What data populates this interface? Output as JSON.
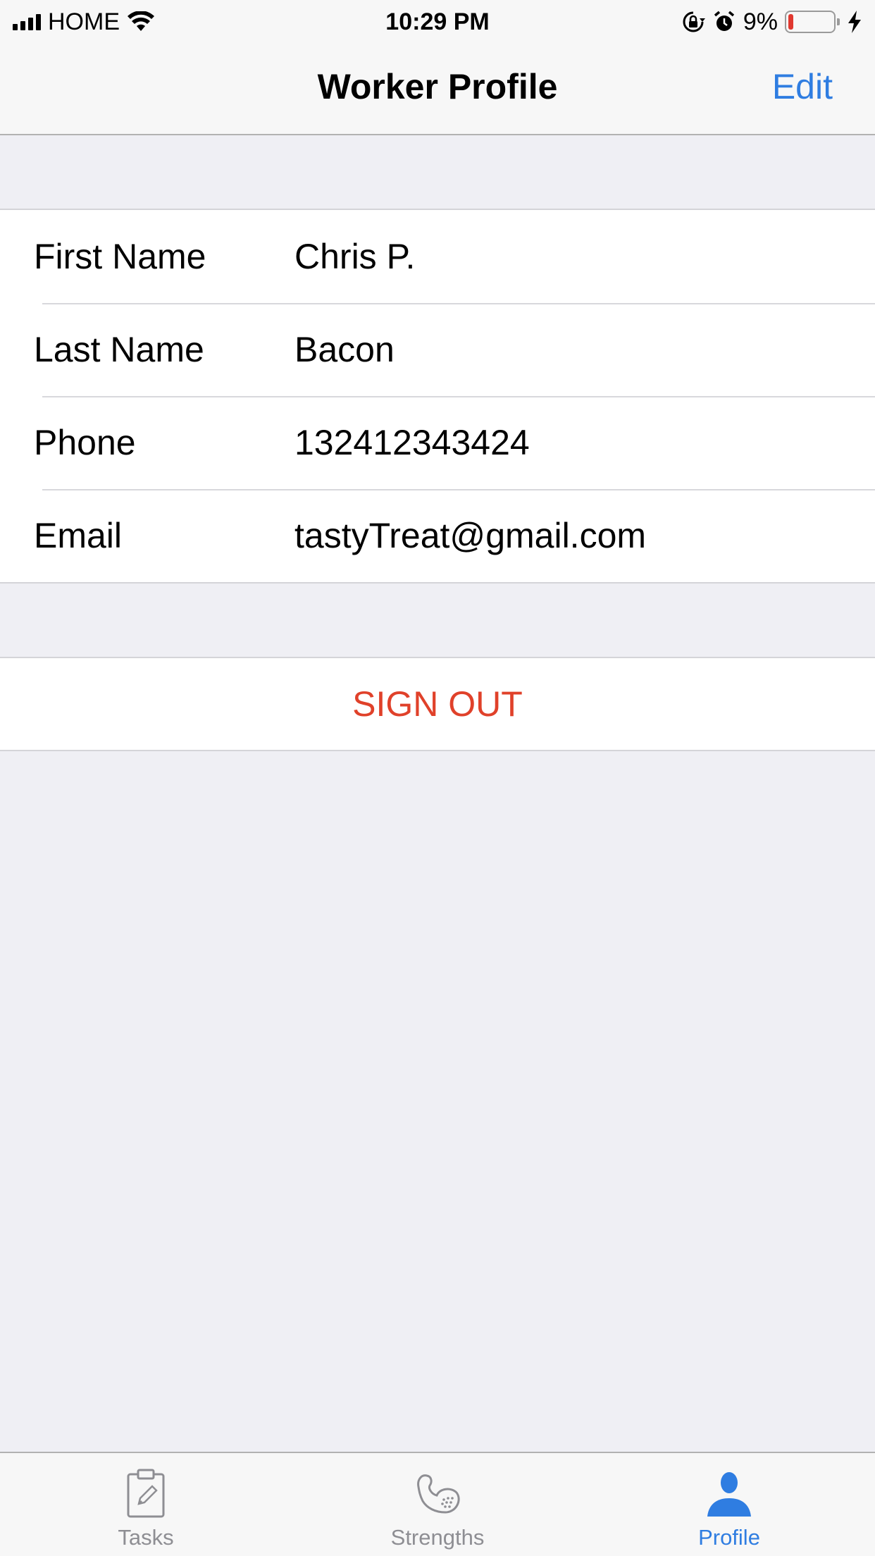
{
  "status_bar": {
    "carrier": "HOME",
    "time": "10:29 PM",
    "battery_percent": "9%",
    "battery_level": 0.09,
    "battery_color": "#e0382f",
    "icons": [
      "signal-icon",
      "wifi-icon",
      "rotation-lock-icon",
      "alarm-icon",
      "battery-icon",
      "charging-icon"
    ]
  },
  "nav": {
    "title": "Worker Profile",
    "edit_label": "Edit"
  },
  "profile": {
    "fields": [
      {
        "label": "First Name",
        "value": "Chris P."
      },
      {
        "label": "Last Name",
        "value": "Bacon"
      },
      {
        "label": "Phone",
        "value": "132412343424"
      },
      {
        "label": "Email",
        "value": "tastyTreat@gmail.com"
      }
    ]
  },
  "actions": {
    "sign_out_label": "SIGN OUT"
  },
  "tab_bar": {
    "tabs": [
      {
        "label": "Tasks",
        "icon": "clipboard-icon",
        "active": false
      },
      {
        "label": "Strengths",
        "icon": "bicep-icon",
        "active": false
      },
      {
        "label": "Profile",
        "icon": "person-icon",
        "active": true
      }
    ]
  },
  "colors": {
    "accent": "#2f7de1",
    "destructive": "#e0412a",
    "inactive_tab": "#8e8e93",
    "background": "#efeff4"
  }
}
